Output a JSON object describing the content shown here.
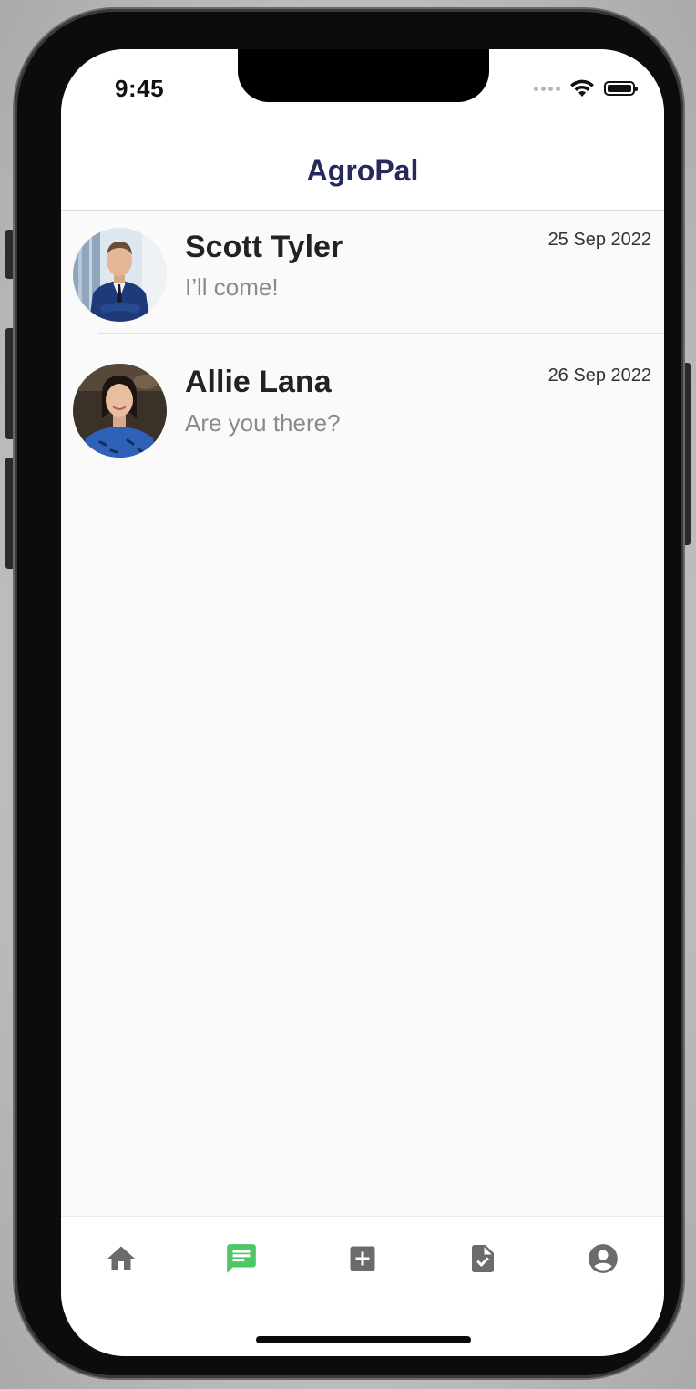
{
  "status_bar": {
    "time": "9:45"
  },
  "app_bar": {
    "title": "AgroPal"
  },
  "chats": [
    {
      "name": "Scott Tyler",
      "last_message": "I’ll come!",
      "date": "25 Sep 2022"
    },
    {
      "name": "Allie Lana",
      "last_message": "Are you there?",
      "date": "26 Sep 2022"
    }
  ],
  "bottom_nav": {
    "active_tab": "messages",
    "items": [
      "home-icon",
      "chat-icon",
      "add-box-icon",
      "document-check-icon",
      "account-circle-icon"
    ],
    "colors": {
      "active": "#4cc764",
      "inactive": "#6b6b6b"
    }
  },
  "colors": {
    "title": "#252a5a",
    "name": "#222222",
    "message": "#8a8a8a",
    "background": "#fafafa"
  }
}
